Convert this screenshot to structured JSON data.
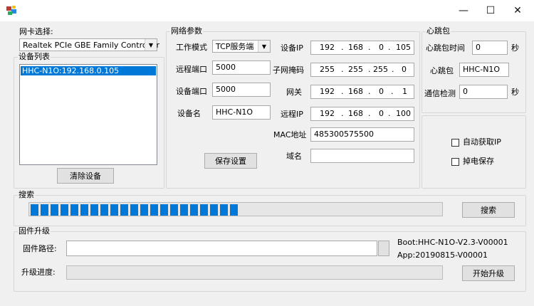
{
  "window": {
    "minimize": "—",
    "maximize": "☐",
    "close": "✕"
  },
  "nic": {
    "label": "网卡选择:",
    "selected": "Realtek PCIe GBE Family Controller"
  },
  "devices": {
    "legend": "设备列表",
    "items": [
      "HHC-N1O:192.168.0.105"
    ],
    "clear_button": "清除设备"
  },
  "network": {
    "legend": "网络参数",
    "work_mode_label": "工作模式",
    "work_mode": "TCP服务端",
    "remote_port_label": "远程端口",
    "remote_port": "5000",
    "device_port_label": "设备端口",
    "device_port": "5000",
    "device_name_label": "设备名",
    "device_name": "HHC-N1O",
    "device_ip_label": "设备IP",
    "device_ip": [
      "192",
      "168",
      "0",
      "105"
    ],
    "subnet_label": "子网掩码",
    "subnet": [
      "255",
      "255",
      "255",
      "0"
    ],
    "gateway_label": "网关",
    "gateway": [
      "192",
      "168",
      "0",
      "1"
    ],
    "remote_ip_label": "远程IP",
    "remote_ip": [
      "192",
      "168",
      "0",
      "100"
    ],
    "mac_label": "MAC地址",
    "mac": "485300575500",
    "domain_label": "域名",
    "domain": "",
    "save_button": "保存设置"
  },
  "heartbeat": {
    "legend": "心跳包",
    "interval_label": "心跳包时间",
    "interval": "0",
    "interval_unit": "秒",
    "packet_label": "心跳包",
    "packet": "HHC-N1O",
    "detect_label": "通信检测",
    "detect": "0",
    "detect_unit": "秒"
  },
  "options": {
    "auto_ip": "自动获取IP",
    "power_save": "掉电保存"
  },
  "search": {
    "legend": "搜索",
    "button": "搜索",
    "progress_percent": 50
  },
  "firmware": {
    "legend": "固件升级",
    "path_label": "固件路径:",
    "path": "",
    "progress_label": "升级进度:",
    "boot": "Boot:HHC-N1O-V2.3-V00001",
    "app": "App:20190815-V00001",
    "upgrade_button": "开始升级"
  }
}
